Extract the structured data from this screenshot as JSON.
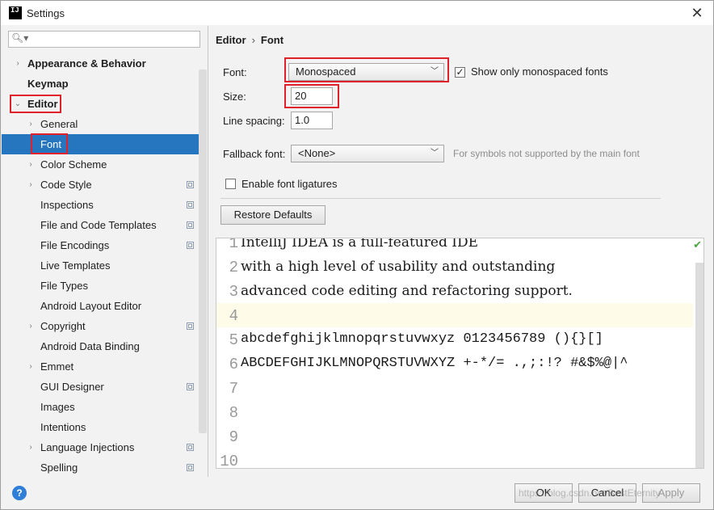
{
  "window": {
    "title": "Settings",
    "app_icon_text": "IJ"
  },
  "search": {
    "value": "",
    "placeholder": ""
  },
  "tree": [
    {
      "label": "Appearance & Behavior",
      "level": 0,
      "arrow": "›",
      "bold": true
    },
    {
      "label": "Keymap",
      "level": 0,
      "arrow": "",
      "bold": true
    },
    {
      "label": "Editor",
      "level": 0,
      "arrow": "⌄",
      "bold": true
    },
    {
      "label": "General",
      "level": 1,
      "arrow": "›"
    },
    {
      "label": "Font",
      "level": 1,
      "arrow": "",
      "selected": true
    },
    {
      "label": "Color Scheme",
      "level": 1,
      "arrow": "›"
    },
    {
      "label": "Code Style",
      "level": 1,
      "arrow": "›",
      "copy": true
    },
    {
      "label": "Inspections",
      "level": 1,
      "arrow": "",
      "copy": true
    },
    {
      "label": "File and Code Templates",
      "level": 1,
      "arrow": "",
      "copy": true
    },
    {
      "label": "File Encodings",
      "level": 1,
      "arrow": "",
      "copy": true
    },
    {
      "label": "Live Templates",
      "level": 1,
      "arrow": ""
    },
    {
      "label": "File Types",
      "level": 1,
      "arrow": ""
    },
    {
      "label": "Android Layout Editor",
      "level": 1,
      "arrow": ""
    },
    {
      "label": "Copyright",
      "level": 1,
      "arrow": "›",
      "copy": true
    },
    {
      "label": "Android Data Binding",
      "level": 1,
      "arrow": ""
    },
    {
      "label": "Emmet",
      "level": 1,
      "arrow": "›"
    },
    {
      "label": "GUI Designer",
      "level": 1,
      "arrow": "",
      "copy": true
    },
    {
      "label": "Images",
      "level": 1,
      "arrow": ""
    },
    {
      "label": "Intentions",
      "level": 1,
      "arrow": ""
    },
    {
      "label": "Language Injections",
      "level": 1,
      "arrow": "›",
      "copy": true
    },
    {
      "label": "Spelling",
      "level": 1,
      "arrow": "",
      "copy": true
    }
  ],
  "breadcrumb": {
    "parent": "Editor",
    "separator": "›",
    "current": "Font"
  },
  "form": {
    "font_label": "Font:",
    "font_value": "Monospaced",
    "show_mono_label": "Show only monospaced fonts",
    "show_mono_checked": "✓",
    "size_label": "Size:",
    "size_value": "20",
    "line_spacing_label": "Line spacing:",
    "line_spacing_value": "1.0",
    "fallback_label": "Fallback font:",
    "fallback_value": "<None>",
    "fallback_hint": "For symbols not supported by the main font",
    "ligatures_label": "Enable font ligatures",
    "ligatures_checked": "",
    "restore_label": "Restore Defaults"
  },
  "preview": {
    "lines": [
      {
        "n": "1",
        "text": "IntelliJ IDEA is a full-featured IDE"
      },
      {
        "n": "2",
        "text": "with a high level of usability and outstanding"
      },
      {
        "n": "3",
        "text": "advanced code editing and refactoring support."
      },
      {
        "n": "4",
        "text": ""
      },
      {
        "n": "5",
        "text": "abcdefghijklmnopqrstuvwxyz 0123456789 (){}[]"
      },
      {
        "n": "6",
        "text": "ABCDEFGHIJKLMNOPQRSTUVWXYZ +-*/= .,;:!? #&$%@|^"
      },
      {
        "n": "7",
        "text": ""
      },
      {
        "n": "8",
        "text": ""
      },
      {
        "n": "9",
        "text": ""
      },
      {
        "n": "10",
        "text": ""
      }
    ],
    "current_line": 4
  },
  "buttons": {
    "ok": "OK",
    "cancel": "Cancel",
    "apply": "Apply",
    "help": "?"
  },
  "watermark": "https://blog.csdn.net/BestEternity",
  "colors": {
    "selection": "#2675bf",
    "highlight_box": "#e0202a",
    "current_line": "#fefbe9"
  }
}
